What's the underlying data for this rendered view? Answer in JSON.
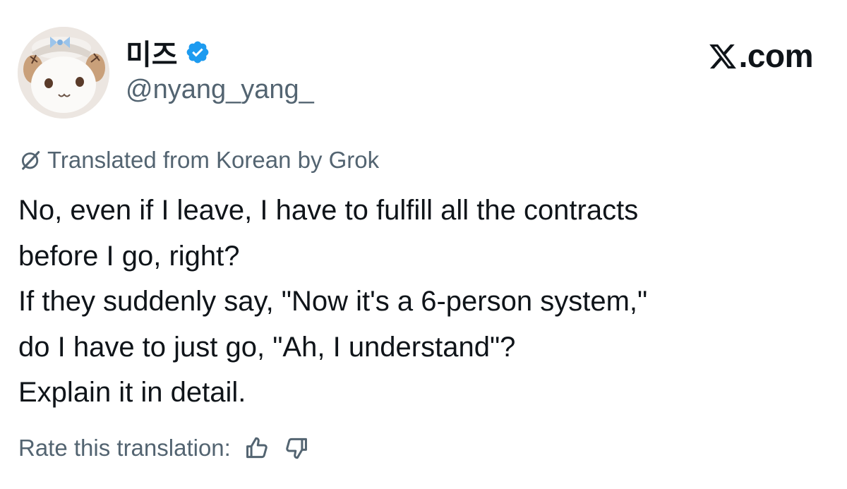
{
  "author": {
    "display_name": "미즈",
    "handle": "@nyang_yang_",
    "verified": true,
    "verified_color": "#1d9bf0"
  },
  "brand": {
    "site_label": ".com",
    "logo": "x-logo-icon"
  },
  "translation": {
    "notice": "Translated from Korean by Grok",
    "icon": "grok-icon"
  },
  "tweet": {
    "lines": [
      "No, even if I leave, I have to fulfill all the contracts",
      "before I go, right?",
      "If they suddenly say, \"Now it's a 6-person system,\"",
      "do I have to just go, \"Ah, I understand\"?",
      "Explain it in detail."
    ]
  },
  "rating": {
    "label": "Rate this translation:",
    "up_icon": "thumbs-up-icon",
    "down_icon": "thumbs-down-icon"
  },
  "colors": {
    "text_primary": "#0f1419",
    "text_secondary": "#536471",
    "accent": "#1d9bf0"
  }
}
